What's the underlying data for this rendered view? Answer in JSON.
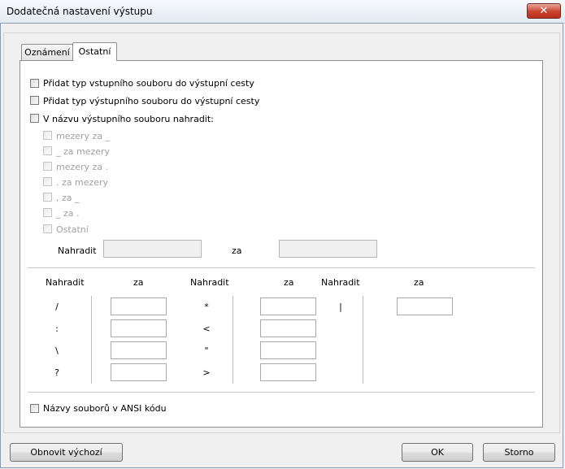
{
  "window": {
    "title": "Dodatečná nastavení výstupu",
    "close_glyph": "✕"
  },
  "tabs": [
    {
      "label": "Oznámení"
    },
    {
      "label": "Ostatní"
    }
  ],
  "options": {
    "add_input_type": "Přidat typ vstupního souboru do výstupní cesty",
    "add_output_type": "Přidat typ výstupního souboru do výstupní cesty",
    "replace_in_name": "V názvu výstupního souboru nahradit:",
    "sub_options": [
      "mezery za _",
      "_ za mezery",
      "mezery za .",
      ". za mezery",
      ", za _",
      "_ za .",
      "Ostatní"
    ],
    "replace_label": "Nahradit",
    "with_label": "za"
  },
  "char_table": {
    "headers": [
      "Nahradit",
      "za",
      "Nahradit",
      "za",
      "Nahradit",
      "za"
    ],
    "col1_chars": [
      "/",
      ":",
      "\\",
      "?"
    ],
    "col2_chars": [
      "*",
      "<",
      "\"",
      ">"
    ],
    "col3_chars": [
      "|"
    ]
  },
  "ansi_option": "Názvy souborů v ANSI kódu",
  "buttons": {
    "reset": "Obnovit výchozí",
    "ok": "OK",
    "cancel": "Storno"
  }
}
